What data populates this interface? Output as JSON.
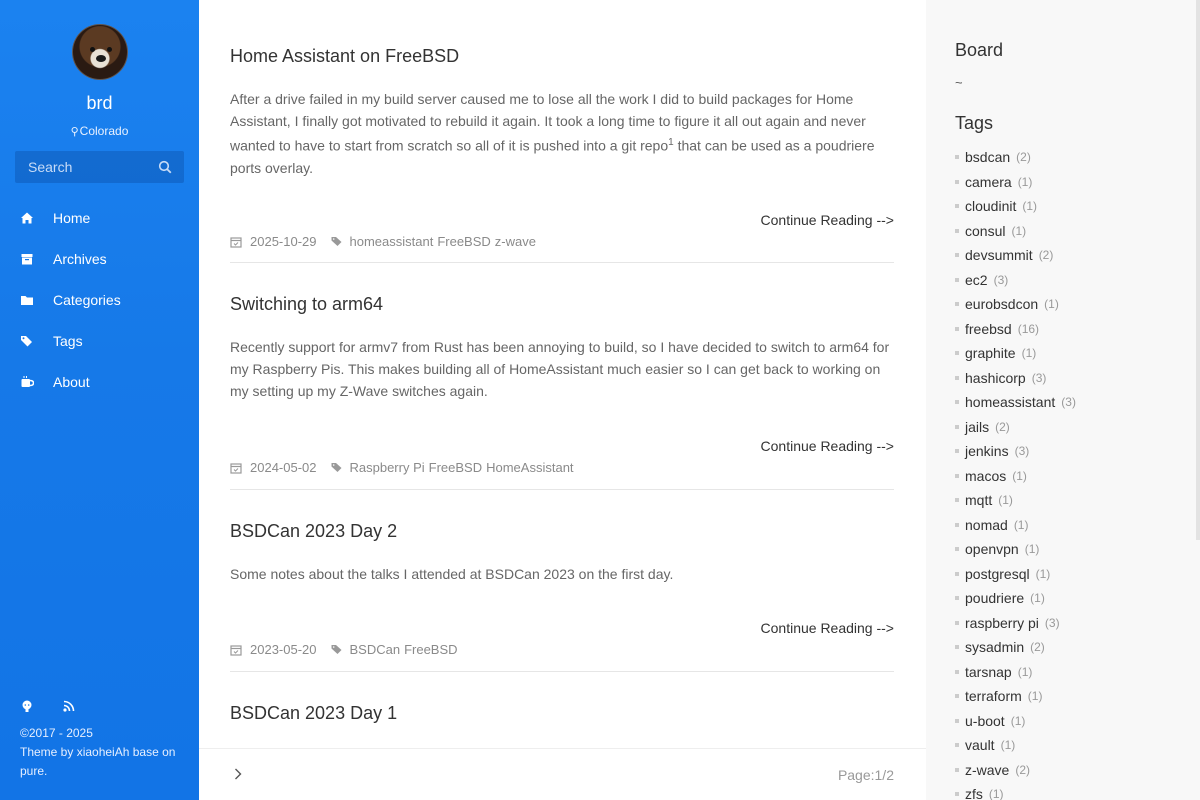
{
  "sidebar": {
    "site_name": "brd",
    "location": "Colorado",
    "search": {
      "placeholder": "Search"
    },
    "nav": [
      {
        "label": "Home",
        "icon": "home-icon"
      },
      {
        "label": "Archives",
        "icon": "archive-icon"
      },
      {
        "label": "Categories",
        "icon": "folder-icon"
      },
      {
        "label": "Tags",
        "icon": "tags-icon"
      },
      {
        "label": "About",
        "icon": "coffee-icon"
      }
    ],
    "social_icons": [
      "github-icon",
      "rss-icon"
    ],
    "copyright": "©2017 - 2025",
    "theme_credit": "Theme by xiaoheiAh base on pure."
  },
  "posts": [
    {
      "title": "Home Assistant on FreeBSD",
      "excerpt_before": "After a drive failed in my build server caused me to lose all the work I did to build packages for Home Assistant, I finally got motivated to rebuild it again. It took a long time to figure it all out again and never wanted to have to start from scratch so all of it is pushed into a git repo",
      "footnote": "1",
      "excerpt_after": " that can be used as a poudriere ports overlay.",
      "continue": "Continue Reading -->",
      "date": "2025-10-29",
      "tags": [
        "homeassistant",
        "FreeBSD",
        "z-wave"
      ]
    },
    {
      "title": "Switching to arm64",
      "excerpt_before": "Recently support for armv7 from Rust has been annoying to build, so I have decided to switch to arm64 for my Raspberry Pis. This makes building all of HomeAssistant much easier so I can get back to working on my setting up my Z-Wave switches again.",
      "continue": "Continue Reading -->",
      "date": "2024-05-02",
      "tags": [
        "Raspberry Pi",
        "FreeBSD",
        "HomeAssistant"
      ]
    },
    {
      "title": "BSDCan 2023 Day 2",
      "excerpt_before": "Some notes about the talks I attended at BSDCan 2023 on the first day.",
      "continue": "Continue Reading -->",
      "date": "2023-05-20",
      "tags": [
        "BSDCan",
        "FreeBSD"
      ]
    },
    {
      "title": "BSDCan 2023 Day 1"
    }
  ],
  "pager": {
    "page_info": "Page:1/2",
    "next_icon": "chevron-right-icon"
  },
  "right": {
    "board_title": "Board",
    "board_text": "~",
    "tags_title": "Tags",
    "tags": [
      {
        "name": "bsdcan",
        "count": "(2)"
      },
      {
        "name": "camera",
        "count": "(1)"
      },
      {
        "name": "cloudinit",
        "count": "(1)"
      },
      {
        "name": "consul",
        "count": "(1)"
      },
      {
        "name": "devsummit",
        "count": "(2)"
      },
      {
        "name": "ec2",
        "count": "(3)"
      },
      {
        "name": "eurobsdcon",
        "count": "(1)"
      },
      {
        "name": "freebsd",
        "count": "(16)"
      },
      {
        "name": "graphite",
        "count": "(1)"
      },
      {
        "name": "hashicorp",
        "count": "(3)"
      },
      {
        "name": "homeassistant",
        "count": "(3)"
      },
      {
        "name": "jails",
        "count": "(2)"
      },
      {
        "name": "jenkins",
        "count": "(3)"
      },
      {
        "name": "macos",
        "count": "(1)"
      },
      {
        "name": "mqtt",
        "count": "(1)"
      },
      {
        "name": "nomad",
        "count": "(1)"
      },
      {
        "name": "openvpn",
        "count": "(1)"
      },
      {
        "name": "postgresql",
        "count": "(1)"
      },
      {
        "name": "poudriere",
        "count": "(1)"
      },
      {
        "name": "raspberry pi",
        "count": "(3)"
      },
      {
        "name": "sysadmin",
        "count": "(2)"
      },
      {
        "name": "tarsnap",
        "count": "(1)"
      },
      {
        "name": "terraform",
        "count": "(1)"
      },
      {
        "name": "u-boot",
        "count": "(1)"
      },
      {
        "name": "vault",
        "count": "(1)"
      },
      {
        "name": "z-wave",
        "count": "(2)"
      },
      {
        "name": "zfs",
        "count": "(1)"
      }
    ]
  }
}
